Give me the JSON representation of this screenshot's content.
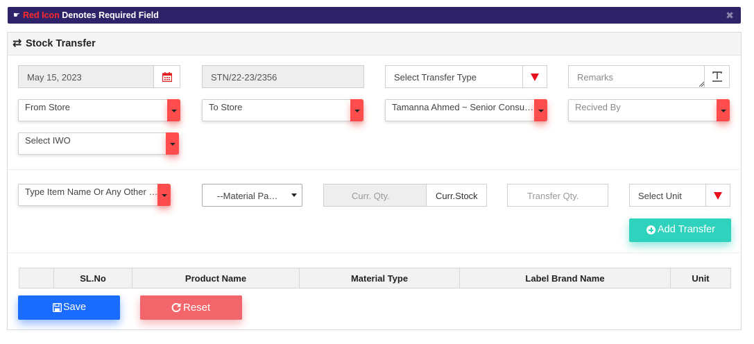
{
  "notice": {
    "highlight": "Red Icon",
    "text": "Denotes Required Field",
    "close": "✖"
  },
  "panel": {
    "title": "Stock Transfer"
  },
  "row1": {
    "date": "May 15, 2023",
    "stn": "STN/22-23/2356",
    "transfer_type": "Select Transfer Type",
    "remarks_placeholder": "Remarks"
  },
  "row2": {
    "from_store": "From Store",
    "to_store": "To Store",
    "employee": "Tamanna Ahmed ~ Senior Consu…",
    "received_by": "Recived By"
  },
  "row3": {
    "iwo": "Select IWO"
  },
  "item_row": {
    "item": "Type Item Name Or Any Other …",
    "material": "--Material Pa…",
    "curr_qty_placeholder": "Curr. Qty.",
    "curr_stock": "Curr.Stock",
    "transfer_qty_placeholder": "Transfer Qty.",
    "unit": "Select Unit"
  },
  "add_transfer_label": "Add Transfer",
  "table": {
    "headers": [
      "",
      "SL.No",
      "Product Name",
      "Material Type",
      "Label Brand Name",
      "Unit"
    ]
  },
  "actions": {
    "save": "Save",
    "reset": "Reset"
  },
  "colors": {
    "header_bar": "#2e2368",
    "required_red": "#ff4d4d",
    "teal": "#2fd3bd",
    "blue": "#1a6cff",
    "reset": "#f2656a"
  }
}
